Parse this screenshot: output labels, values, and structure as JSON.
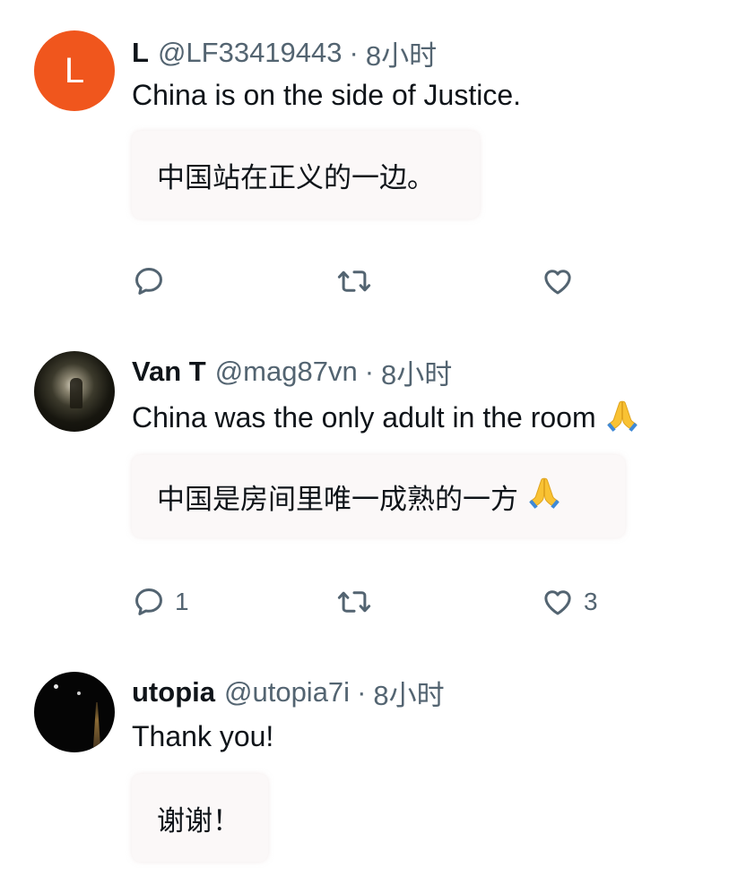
{
  "replies": [
    {
      "avatar_letter": "L",
      "name": "L",
      "handle": "@LF33419443",
      "separator": "·",
      "time": "8小时",
      "text": "China is on the side of Justice.",
      "translation": "中国站在正义的一边。",
      "reply_count": "",
      "like_count": ""
    },
    {
      "name": "Van T",
      "handle": "@mag87vn",
      "separator": "·",
      "time": "8小时",
      "text": "China was the only adult in the room",
      "translation": "中国是房间里唯一成熟的一方",
      "reply_count": "1",
      "like_count": "3"
    },
    {
      "name": "utopia",
      "handle": "@utopia7i",
      "separator": "·",
      "time": "8小时",
      "text": "Thank you!",
      "translation": "谢谢！",
      "reply_count": "",
      "like_count": ""
    }
  ],
  "icons": {
    "reply": "reply-icon",
    "retweet": "retweet-icon",
    "like": "heart-icon",
    "emoji": "folded-hands-emoji"
  },
  "colors": {
    "avatar_l": "#f0561d",
    "secondary_text": "#536471",
    "primary_text": "#0f1419",
    "translation_bg": "#fbf8f8"
  }
}
